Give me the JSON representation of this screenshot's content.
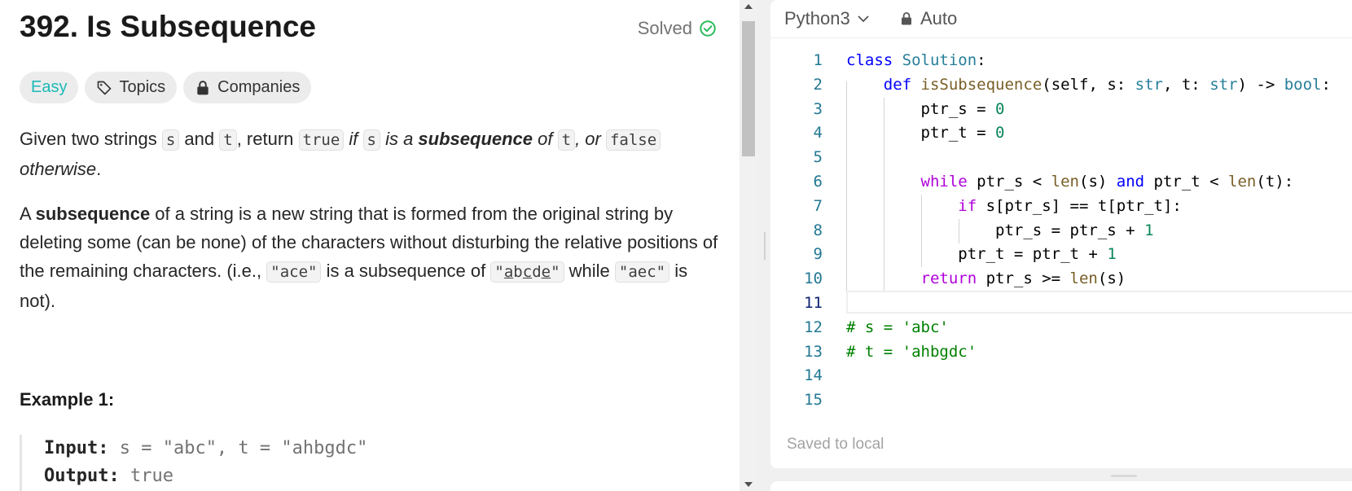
{
  "problem": {
    "title": "392. Is Subsequence",
    "status": "Solved",
    "difficulty": "Easy",
    "topics_label": "Topics",
    "companies_label": "Companies"
  },
  "description": {
    "p1": {
      "t1": "Given two strings ",
      "c1": "s",
      "t2": " and ",
      "c2": "t",
      "t3": ", return ",
      "c3": "true",
      "i1": " if ",
      "c4": "s",
      "i2": " is a ",
      "b1": "subsequence",
      "i3": " of ",
      "c5": "t",
      "i4": ", or ",
      "c6": "false",
      "i5": "otherwise",
      "t4": "."
    },
    "p2": {
      "t1": "A ",
      "b1": "subsequence",
      "t2": " of a string is a new string that is formed from the original string by deleting some (can be none) of the characters without disturbing the relative positions of the remaining characters. (i.e., ",
      "c1": "\"ace\"",
      "t3": " is a subsequence of ",
      "c2a": "\"",
      "c2b": "a",
      "c2c": "b",
      "c2d": "c",
      "c2e": "d",
      "c2f": "e",
      "c2g": "\"",
      "t4": " while ",
      "c3": "\"aec\"",
      "t5": " is not)."
    }
  },
  "example": {
    "title": "Example 1:",
    "input_label": "Input:",
    "input_value": " s = \"abc\", t = \"ahbgdc\"",
    "output_label": "Output:",
    "output_value": " true"
  },
  "editor": {
    "language": "Python3",
    "mode": "Auto",
    "saved_status": "Saved to local",
    "line_numbers": [
      "1",
      "2",
      "3",
      "4",
      "5",
      "6",
      "7",
      "8",
      "9",
      "10",
      "11",
      "12",
      "13",
      "14",
      "15"
    ],
    "code": {
      "l1_kw": "class",
      "l1_cls": "Solution",
      "l1_rest": ":",
      "l2_kw": "def",
      "l2_fn": "isSubsequence",
      "l2_a": "(self, s: ",
      "l2_t1": "str",
      "l2_b": ", t: ",
      "l2_t2": "str",
      "l2_c": ") -> ",
      "l2_t3": "bool",
      "l2_d": ":",
      "l3_a": "ptr_s = ",
      "l3_n": "0",
      "l4_a": "ptr_t = ",
      "l4_n": "0",
      "l6_kw": "while",
      "l6_a": " ptr_s < ",
      "l6_fn1": "len",
      "l6_b": "(s) ",
      "l6_and": "and",
      "l6_c": " ptr_t < ",
      "l6_fn2": "len",
      "l6_d": "(t):",
      "l7_kw": "if",
      "l7_a": " s[ptr_s] == t[ptr_t]:",
      "l8_a": "ptr_s = ptr_s + ",
      "l8_n": "1",
      "l9_a": "ptr_t = ptr_t + ",
      "l9_n": "1",
      "l10_kw": "return",
      "l10_a": " ptr_s >= ",
      "l10_fn": "len",
      "l10_b": "(s)",
      "l12_a": "# s = 'abc'",
      "l13_a": "# t = 'ahbgdc'"
    }
  },
  "colors": {
    "easy": "#1cb8b8",
    "solved_check": "#2cbb5d",
    "keyword": "#0000ff",
    "control": "#af00db",
    "class": "#267f99",
    "function": "#795e26",
    "number": "#098658",
    "comment": "#008000"
  }
}
